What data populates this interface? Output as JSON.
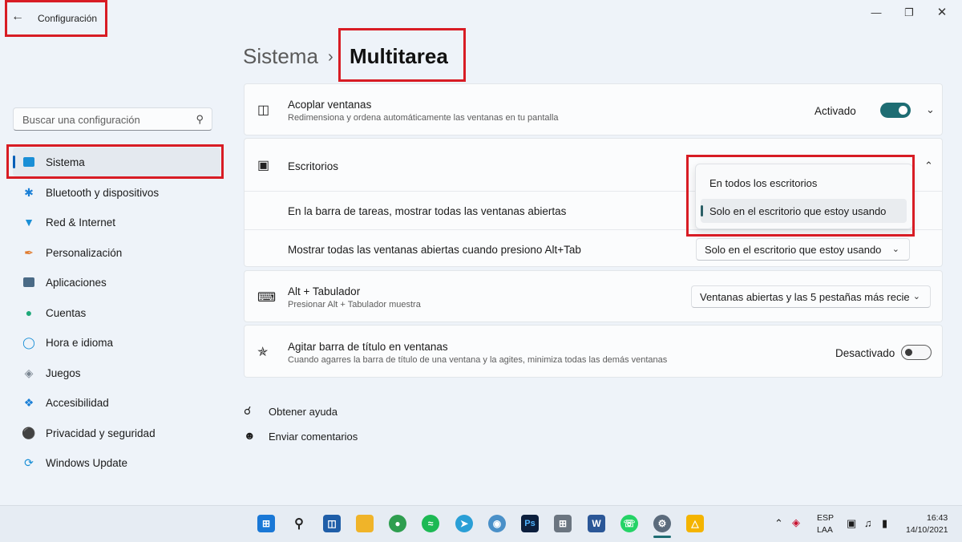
{
  "window": {
    "title": "Configuración"
  },
  "search": {
    "placeholder": "Buscar una configuración"
  },
  "sidebar": {
    "items": [
      {
        "label": "Sistema",
        "icon": "system-icon",
        "color": "#1a8fd6"
      },
      {
        "label": "Bluetooth y dispositivos",
        "icon": "bluetooth-icon",
        "color": "#1a7fd6"
      },
      {
        "label": "Red & Internet",
        "icon": "wifi-icon",
        "color": "#1a8fd6"
      },
      {
        "label": "Personalización",
        "icon": "brush-icon",
        "color": "#e07a2c"
      },
      {
        "label": "Aplicaciones",
        "icon": "apps-icon",
        "color": "#4a6a86"
      },
      {
        "label": "Cuentas",
        "icon": "account-icon",
        "color": "#1fa97a"
      },
      {
        "label": "Hora e idioma",
        "icon": "globe-clock-icon",
        "color": "#1a8fd6"
      },
      {
        "label": "Juegos",
        "icon": "gamepad-icon",
        "color": "#7a8591"
      },
      {
        "label": "Accesibilidad",
        "icon": "accessibility-icon",
        "color": "#1a7fd6"
      },
      {
        "label": "Privacidad y seguridad",
        "icon": "shield-icon",
        "color": "#6f7a85"
      },
      {
        "label": "Windows Update",
        "icon": "update-icon",
        "color": "#1a8fd6"
      }
    ]
  },
  "breadcrumb": {
    "parent": "Sistema",
    "separator": "›",
    "current": "Multitarea"
  },
  "snap": {
    "title": "Acoplar ventanas",
    "subtitle": "Redimensiona y ordena automáticamente las ventanas en tu pantalla",
    "state_label": "Activado"
  },
  "desktops": {
    "title": "Escritorios",
    "row1_label": "En la barra de tareas, mostrar todas las ventanas abiertas",
    "row2_label": "Mostrar todas las ventanas abiertas cuando presiono Alt+Tab",
    "row2_value": "Solo en el escritorio que estoy usando",
    "menu_options": [
      "En todos los escritorios",
      "Solo en el escritorio que estoy usando"
    ],
    "menu_selected": "Solo en el escritorio que estoy usando"
  },
  "alttab": {
    "title": "Alt + Tabulador",
    "subtitle": "Presionar Alt + Tabulador muestra",
    "value": "Ventanas abiertas y las 5 pestañas más recie"
  },
  "shake": {
    "title": "Agitar barra de título en ventanas",
    "subtitle": "Cuando agarres la barra de título de una ventana y la agites, minimiza todas las demás ventanas",
    "state_label": "Desactivado"
  },
  "help": {
    "get_help": "Obtener ayuda",
    "feedback": "Enviar comentarios"
  },
  "taskbar": {
    "lang_top": "ESP",
    "lang_bottom": "LAA",
    "time": "16:43",
    "date": "14/10/2021"
  },
  "colors": {
    "accent": "#1e6d73",
    "highlight_box": "#d81c24"
  }
}
